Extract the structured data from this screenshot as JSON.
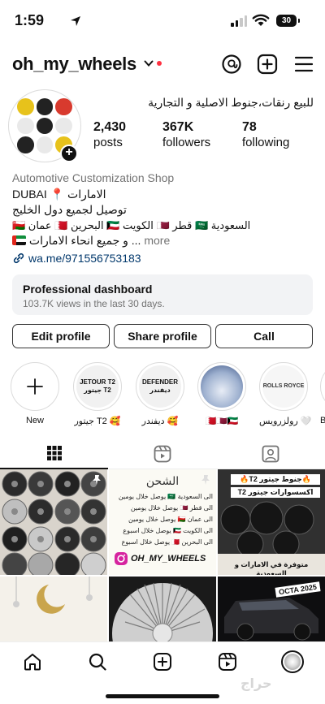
{
  "status_bar": {
    "time": "1:59",
    "battery": "30"
  },
  "header": {
    "username": "oh_my_wheels"
  },
  "profile": {
    "full_name": "للبيع رنقات،جنوط الاصلية و التجارية",
    "stats": [
      {
        "value": "2,430",
        "label": "posts"
      },
      {
        "value": "367K",
        "label": "followers"
      },
      {
        "value": "78",
        "label": "following"
      }
    ],
    "category": "Automotive Customization Shop",
    "bio_line1": "الامارات 📍 DUBAI",
    "bio_line2": "توصيل لجميع دول الخليج",
    "bio_line3": "السعودية 🇸🇦 قطر 🇶🇦 الكويت 🇰🇼 البحرين 🇧🇭 عمان 🇴🇲",
    "bio_line4": "و جميع انحاء الامارات ... ",
    "more_label": "more",
    "link": "wa.me/971556753183"
  },
  "dashboard": {
    "title": "Professional dashboard",
    "subtitle": "103.7K views in the last 30 days."
  },
  "buttons": {
    "edit": "Edit profile",
    "share": "Share profile",
    "call": "Call"
  },
  "highlights": [
    {
      "label": "New",
      "inner": ""
    },
    {
      "label": "جيتور T2 🥰",
      "inner": "JETOUR T2 جيتور T2"
    },
    {
      "label": "ديفندر 🥰",
      "inner": "DEFENDER ديفندر"
    },
    {
      "label": "🇧🇭🇶🇦🇰🇼",
      "inner": ""
    },
    {
      "label": "رولزرويس 🤍",
      "inner": "ROLLS ROYCE"
    },
    {
      "label": "B",
      "inner": ""
    }
  ],
  "posts": {
    "post2_title": "الشحن",
    "post2_lines": [
      "الى السعودية 🇸🇦 يوصل خلال يومين",
      "الى قطر 🇶🇦 يوصل خلال يومين",
      "الى عمان 🇴🇲 يوصل خلال يومين",
      "الى الكويت 🇰🇼 يوصل خلال اسبوع",
      "الى البحرين 🇧🇭 يوصل خلال اسبوع"
    ],
    "post2_handle": "OH_MY_WHEELS",
    "post3_top": "🔥جنوط جيتور T2🔥",
    "post3_sub": "اكسسوارات جيتور T2",
    "post3_bottom": "متوفرة في الامارات و السعودية",
    "post6_badge": "OCTA 2025"
  },
  "watermark": "حراج",
  "colors": {
    "accent": "#0095f6",
    "link": "#00376b",
    "notification": "#ff3040"
  }
}
